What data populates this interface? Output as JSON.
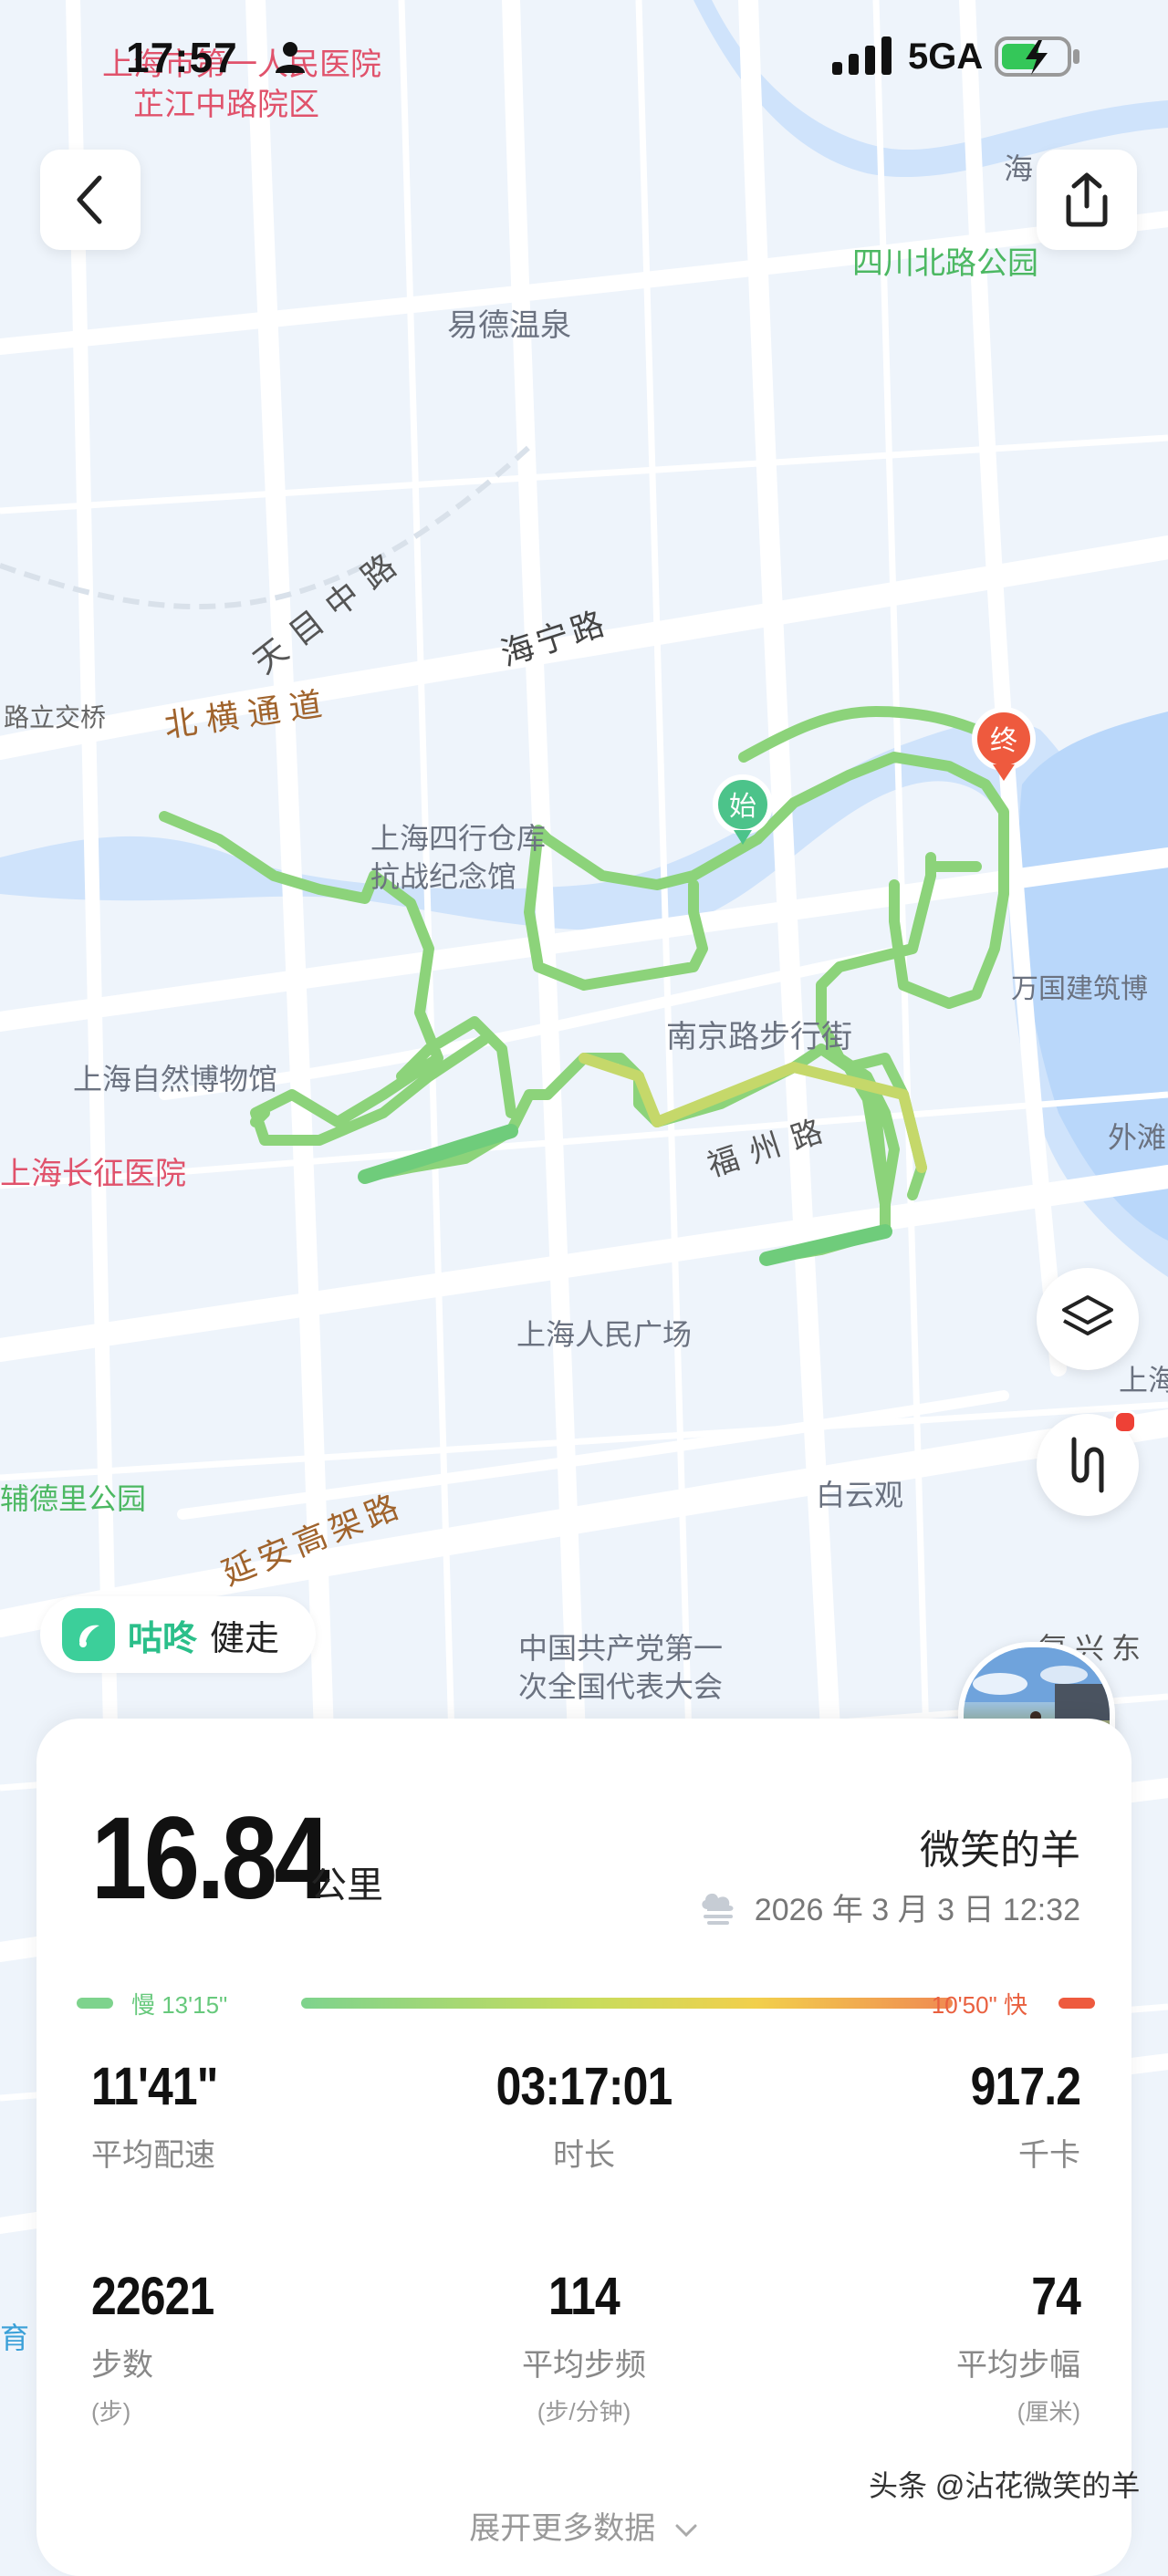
{
  "status_bar": {
    "time": "17:57",
    "network": "5GA"
  },
  "map": {
    "labels": [
      {
        "text": "上海市第一人民医院",
        "kind": "hospital"
      },
      {
        "text": "芷江中路院区",
        "kind": "hospital"
      },
      {
        "text": "易德温泉",
        "kind": "poi"
      },
      {
        "text": "四川北路公园",
        "kind": "park"
      },
      {
        "text": "天目中路",
        "kind": "road"
      },
      {
        "text": "海宁路",
        "kind": "road"
      },
      {
        "text": "北横通道",
        "kind": "highway"
      },
      {
        "text": "路立交桥",
        "kind": "road"
      },
      {
        "text": "上海四行仓库",
        "kind": "poi"
      },
      {
        "text": "抗战纪念馆",
        "kind": "poi"
      },
      {
        "text": "南京路步行街",
        "kind": "poi"
      },
      {
        "text": "万国建筑博",
        "kind": "poi"
      },
      {
        "text": "上海自然博物馆",
        "kind": "poi"
      },
      {
        "text": "上海长征医院",
        "kind": "hospital"
      },
      {
        "text": "福州路",
        "kind": "road"
      },
      {
        "text": "外滩",
        "kind": "poi"
      },
      {
        "text": "上海人民广场",
        "kind": "poi"
      },
      {
        "text": "上海",
        "kind": "poi"
      },
      {
        "text": "辅德里公园",
        "kind": "park"
      },
      {
        "text": "白云观",
        "kind": "poi"
      },
      {
        "text": "延安高架路",
        "kind": "highway"
      },
      {
        "text": "中国共产党第一",
        "kind": "poi"
      },
      {
        "text": "次全国代表大会",
        "kind": "poi"
      },
      {
        "text": "复兴东",
        "kind": "road"
      },
      {
        "text": "海",
        "kind": "poi"
      },
      {
        "text": "育",
        "kind": "park"
      }
    ],
    "start_marker": "始",
    "end_marker": "终",
    "route_color": "#7ed38d"
  },
  "brand": {
    "name": "咕咚",
    "sub": "健走"
  },
  "workout": {
    "distance": "16.84",
    "distance_unit": "公里",
    "username": "微笑的羊",
    "datetime": "2026 年 3 月 3 日 12:32",
    "pace_slow_label": "慢 13'15\"",
    "pace_fast_label": "10'50\" 快",
    "stats": [
      {
        "value": "11'41\"",
        "label": "平均配速",
        "unit": ""
      },
      {
        "value": "03:17:01",
        "label": "时长",
        "unit": ""
      },
      {
        "value": "917.2",
        "label": "千卡",
        "unit": ""
      },
      {
        "value": "22621",
        "label": "步数",
        "unit": "(步)"
      },
      {
        "value": "114",
        "label": "平均步频",
        "unit": "(步/分钟)"
      },
      {
        "value": "74",
        "label": "平均步幅",
        "unit": "(厘米)"
      }
    ],
    "more_label": "展开更多数据"
  },
  "watermark": "头条 @沾花微笑的羊",
  "colors": {
    "accent_green": "#2bbf8a",
    "start_green": "#4cc38a",
    "end_red": "#ee5a3e"
  }
}
